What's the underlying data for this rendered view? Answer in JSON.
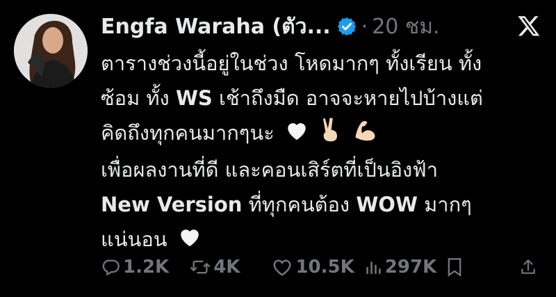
{
  "author": {
    "name": "Engfa Waraha (ตัว...",
    "time_separator": "·",
    "time": "20 ชม."
  },
  "tweet": {
    "lines": {
      "l1": "ตารางช่วงนี้อยู่ในช่วง โหดมากๆ ทั้งเรียน ทั้ง",
      "l2a": "ซ้อม ทั้ง ",
      "l2b": "WS",
      "l2c": " เช้าถึงมืด อาจจะหายไปบ้างแต่",
      "l3": "คิดถึงทุกคนมากๆนะ",
      "l4": "เพื่อผลงานที่ดี และคอนเสิร์ตที่เป็นอิงฟ้า",
      "l5a": "New Version",
      "l5b": " ที่ทุกคนต้อง ",
      "l5c": "WOW",
      "l5d": " มากๆ",
      "l6": "แน่นอน"
    },
    "emojis": [
      "white-heart",
      "victory-hand",
      "flexed-biceps",
      "white-heart"
    ]
  },
  "stats": {
    "replies": "1.2K",
    "reposts": "4K",
    "likes": "10.5K",
    "views": "297K"
  },
  "colors": {
    "background": "#000000",
    "text": "#e7e9ea",
    "muted": "#71767b",
    "verified": "#1d9bf0"
  }
}
